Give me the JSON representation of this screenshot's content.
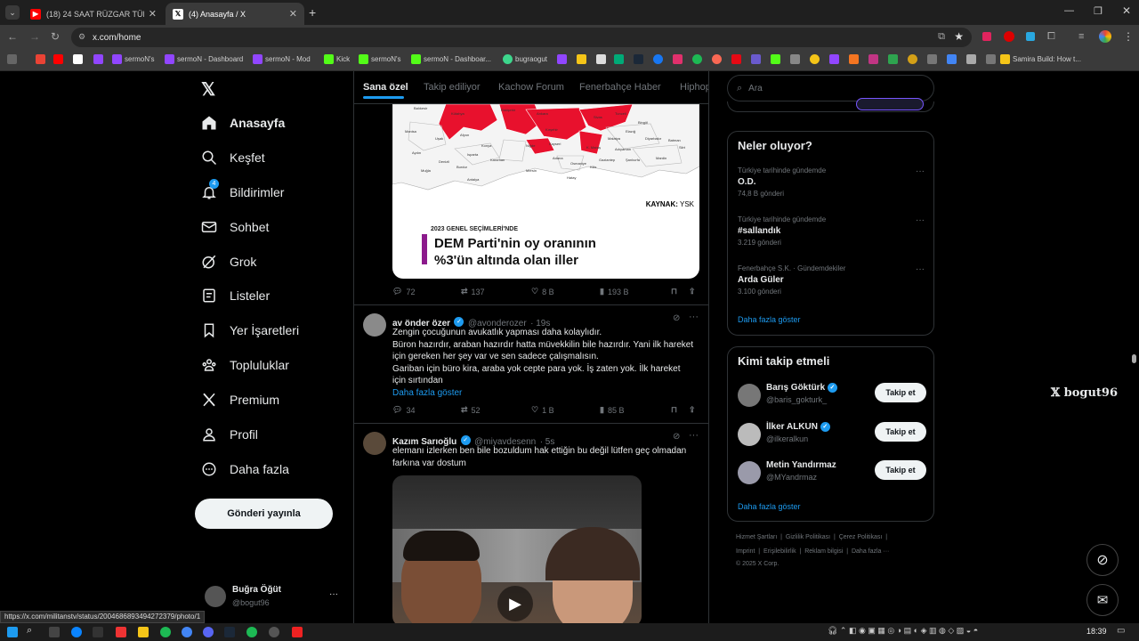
{
  "browser": {
    "tabs": [
      {
        "title": "(18) 24 SAAT RÜZGAR TÜRBİNİ",
        "icon": "youtube-icon",
        "active": false
      },
      {
        "title": "(4) Anasayfa / X",
        "icon": "x-icon",
        "active": true
      }
    ],
    "new_tab": "+",
    "url": "x.com/home",
    "bookmarks": [
      "sermoN's",
      "sermoN - Dashboard",
      "sermoN - Mod",
      "Kick",
      "sermoN's",
      "sermoN - Dashboar...",
      "bugraogut",
      "Samira Build: How t..."
    ],
    "status_url": "https://x.com/militanstv/status/2004686893494272379/photo/1"
  },
  "nav": {
    "items": [
      {
        "label": "Anasayfa",
        "icon": "home-icon"
      },
      {
        "label": "Keşfet",
        "icon": "search-icon"
      },
      {
        "label": "Bildirimler",
        "icon": "bell-icon",
        "badge": "4"
      },
      {
        "label": "Sohbet",
        "icon": "mail-icon"
      },
      {
        "label": "Grok",
        "icon": "grok-icon"
      },
      {
        "label": "Listeler",
        "icon": "list-icon"
      },
      {
        "label": "Yer İşaretleri",
        "icon": "bookmark-icon"
      },
      {
        "label": "Topluluklar",
        "icon": "communities-icon"
      },
      {
        "label": "Premium",
        "icon": "x-icon"
      },
      {
        "label": "Profil",
        "icon": "profile-icon"
      },
      {
        "label": "Daha fazla",
        "icon": "more-icon"
      }
    ],
    "post_button": "Gönderi yayınla",
    "account": {
      "name": "Buğra Öğüt",
      "handle": "@bogut96",
      "more": "···"
    }
  },
  "feed": {
    "tabs": [
      "Sana özel",
      "Takip ediliyor",
      "Kachow Forum",
      "Fenerbahçe Haber",
      "Hiphop"
    ],
    "post1": {
      "map": {
        "source_label": "KAYNAK:",
        "source": "YSK",
        "caption_small": "2023 GENEL SEÇİMLERİ'NDE",
        "caption_line1": "DEM Parti'nin oy oranının",
        "caption_line2": "%3'ün altında olan iller",
        "place_names": [
          "Balıkesir",
          "Manisa",
          "Aydın",
          "Kütahya",
          "Eskişehir",
          "Ankara",
          "Kırşehir",
          "Kayseri",
          "Sivas",
          "Malatya",
          "Adıyaman",
          "Niğde",
          "Konya",
          "Karaman",
          "Mersin",
          "Adana",
          "Osmaniye",
          "Hatay",
          "Kilis",
          "K. Maraş",
          "Gaziantep",
          "Şanlıurfa",
          "Mardin",
          "Diyarbakır",
          "Bingöl",
          "Tunceli",
          "Elazığ",
          "Batman",
          "Siirt",
          "Muğla",
          "Denizli",
          "Burdur",
          "Isparta",
          "Antalya",
          "Uşak",
          "Afyon"
        ]
      },
      "stats": {
        "replies": "72",
        "reposts": "137",
        "likes": "8 B",
        "views": "193 B"
      }
    },
    "post2": {
      "name": "av önder özer",
      "handle": "@avonderozer",
      "time": "· 19s",
      "lines": [
        "Zengin çocuğunun avukatlık yapması daha kolaylıdır.",
        "Büron hazırdır, araban hazırdır hatta müvekkilin bile hazırdır. Yani ilk hareket",
        "için gereken her şey var ve sen sadece çalışmalısın.",
        "Gariban için büro kira, araba yok cepte para yok. İş zaten yok. İlk hareket",
        "için sırtından"
      ],
      "more": "Daha fazla göster",
      "stats": {
        "replies": "34",
        "reposts": "52",
        "likes": "1 B",
        "views": "85 B"
      }
    },
    "post3": {
      "name": "Kazım Sarıoğlu",
      "handle": "@miyavdesenn",
      "time": "· 5s",
      "lines": [
        "elemanı izlerken ben bile bozuldum hak ettiğin bu değil lütfen geç olmadan",
        "farkına var dostum"
      ]
    }
  },
  "right": {
    "search_placeholder": "Ara",
    "trends_title": "Neler oluyor?",
    "trends": [
      {
        "meta": "Türkiye tarihinde gündemde",
        "title": "O.D.",
        "count": "74,8 B gönderi"
      },
      {
        "meta": "Türkiye tarihinde gündemde",
        "title": "#sallandık",
        "count": "3.219 gönderi"
      },
      {
        "meta": "Fenerbahçe S.K. · Gündemdekiler",
        "title": "Arda Güler",
        "count": "3.100 gönderi"
      }
    ],
    "show_more": "Daha fazla göster",
    "follow_title": "Kimi takip etmeli",
    "follow": [
      {
        "name": "Barış Göktürk",
        "handle": "@baris_gokturk_",
        "button": "Takip et"
      },
      {
        "name": "İlker ALKUN",
        "handle": "@ilkeralkun",
        "button": "Takip et"
      },
      {
        "name": "Metin Yandırmaz",
        "handle": "@MYandrmaz",
        "button": "Takip et"
      }
    ],
    "show_more2": "Daha fazla göster",
    "footer_row1": [
      "Hizmet Şartları",
      "Gizlilik Politikası",
      "Çerez Politikası"
    ],
    "footer_row2": [
      "Imprint",
      "Erişilebilirlik",
      "Reklam bilgisi",
      "Daha fazla ···"
    ],
    "copyright": "© 2025 X Corp."
  },
  "watermark": "bogut96",
  "clock": "18:39"
}
